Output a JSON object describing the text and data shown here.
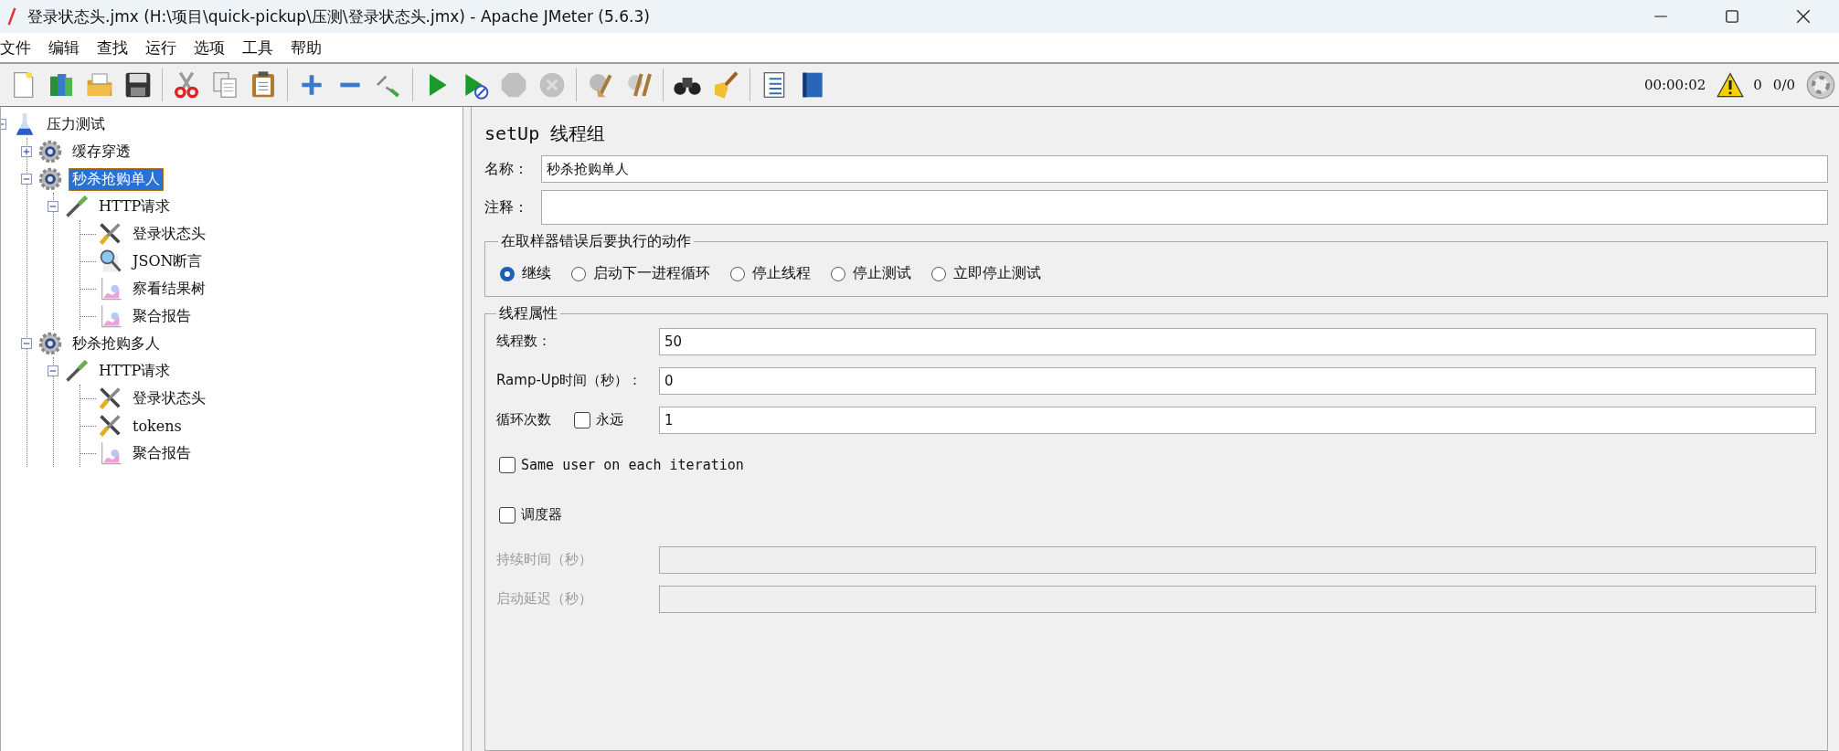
{
  "window": {
    "title": "登录状态头.jmx (H:\\项目\\quick-pickup\\压测\\登录状态头.jmx) - Apache JMeter (5.6.3)"
  },
  "menu": [
    "文件",
    "编辑",
    "查找",
    "运行",
    "选项",
    "工具",
    "帮助"
  ],
  "toolbar": [
    [
      {
        "kind": "new",
        "disabled": false
      },
      {
        "kind": "templates",
        "disabled": false
      },
      {
        "kind": "open",
        "disabled": false
      },
      {
        "kind": "save",
        "disabled": false
      }
    ],
    [
      {
        "kind": "cut",
        "disabled": false
      },
      {
        "kind": "copy",
        "disabled": false
      },
      {
        "kind": "paste",
        "disabled": false
      }
    ],
    [
      {
        "kind": "expand",
        "disabled": false
      },
      {
        "kind": "collapse",
        "disabled": false
      },
      {
        "kind": "toggle",
        "disabled": false
      }
    ],
    [
      {
        "kind": "start",
        "disabled": false
      },
      {
        "kind": "start_no_pause",
        "disabled": false
      },
      {
        "kind": "stop",
        "disabled": true
      },
      {
        "kind": "shutdown",
        "disabled": true
      }
    ],
    [
      {
        "kind": "clear",
        "disabled": false
      },
      {
        "kind": "clear_all",
        "disabled": false
      }
    ],
    [
      {
        "kind": "search",
        "disabled": false
      },
      {
        "kind": "reset_search",
        "disabled": false
      }
    ],
    [
      {
        "kind": "function_helper",
        "disabled": false
      },
      {
        "kind": "help",
        "disabled": false
      }
    ]
  ],
  "status": {
    "elapsed": "00:00:02",
    "error_count": "0",
    "threads": "0/0"
  },
  "tree": [
    {
      "label": "压力测试",
      "kind": "test_plan",
      "expanded": true,
      "selected": false,
      "children": [
        {
          "label": "缓存穿透",
          "kind": "thread_group",
          "expanded": false,
          "selected": false
        },
        {
          "label": "秒杀抢购单人",
          "kind": "thread_group",
          "expanded": true,
          "selected": true,
          "children": [
            {
              "label": "HTTP请求",
              "kind": "sampler",
              "expanded": true,
              "selected": false,
              "children": [
                {
                  "label": "登录状态头",
                  "kind": "config",
                  "selected": false
                },
                {
                  "label": "JSON断言",
                  "kind": "assertion",
                  "selected": false
                },
                {
                  "label": "察看结果树",
                  "kind": "listener",
                  "selected": false
                },
                {
                  "label": "聚合报告",
                  "kind": "listener",
                  "selected": false
                }
              ]
            }
          ]
        },
        {
          "label": "秒杀抢购多人",
          "kind": "thread_group",
          "expanded": true,
          "selected": false,
          "children": [
            {
              "label": "HTTP请求",
              "kind": "sampler",
              "expanded": true,
              "selected": false,
              "children": [
                {
                  "label": "登录状态头",
                  "kind": "config",
                  "selected": false
                },
                {
                  "label": "tokens",
                  "kind": "config",
                  "selected": false
                },
                {
                  "label": "聚合报告",
                  "kind": "listener",
                  "selected": false
                }
              ]
            }
          ]
        }
      ]
    }
  ],
  "panel": {
    "title": "setUp 线程组",
    "name": {
      "label": "名称：",
      "value": "秒杀抢购单人"
    },
    "comments": {
      "label": "注释："
    },
    "on_error": {
      "title": "在取样器错误后要执行的动作",
      "options": [
        {
          "label": "继续",
          "selected": true
        },
        {
          "label": "启动下一进程循环",
          "selected": false
        },
        {
          "label": "停止线程",
          "selected": false
        },
        {
          "label": "停止测试",
          "selected": false
        },
        {
          "label": "立即停止测试",
          "selected": false
        }
      ]
    },
    "thread_properties": {
      "title": "线程属性",
      "rows": [
        {
          "kind": "field",
          "label": "线程数：",
          "value": "50",
          "disabled": false
        },
        {
          "kind": "field",
          "label": "Ramp-Up时间（秒）：",
          "value": "0",
          "disabled": false
        },
        {
          "kind": "loop",
          "label": "循环次数",
          "checkbox_label": "永远",
          "checked": false,
          "value": "1",
          "disabled": false
        },
        {
          "kind": "checkbox",
          "label": "Same user on each iteration",
          "checked": false,
          "disabled": false
        },
        {
          "kind": "checkbox",
          "label": "调度器",
          "checked": false,
          "disabled": false
        },
        {
          "kind": "field",
          "label": "持续时间（秒）",
          "disabled": true
        },
        {
          "kind": "field",
          "label": "启动延迟（秒）",
          "disabled": true
        }
      ]
    }
  }
}
